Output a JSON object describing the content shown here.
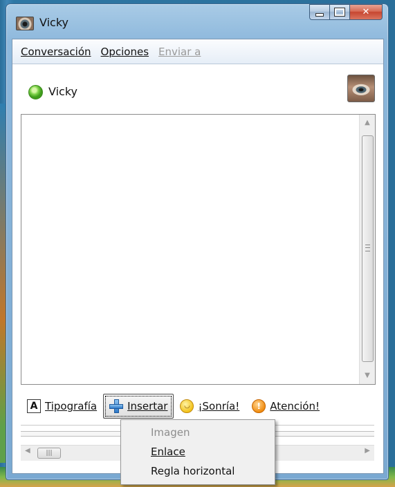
{
  "window": {
    "title": "Vicky"
  },
  "menubar": {
    "items": [
      {
        "label": "Conversación",
        "enabled": true
      },
      {
        "label": "Opciones",
        "enabled": true
      },
      {
        "label": "Enviar a",
        "enabled": false
      }
    ]
  },
  "contact": {
    "name": "Vicky",
    "status_color": "#5cbf2a"
  },
  "toolbar": {
    "typography_label": "Tipografía",
    "insert_label": "Insertar",
    "smile_label": "¡Sonría!",
    "attention_label": "Atención!"
  },
  "insert_menu": {
    "image_label": "Imagen",
    "link_label": "Enlace",
    "rule_label": "Regla horizontal"
  },
  "icons": {
    "typography": "letter-a-icon",
    "insert": "plus-icon",
    "smile": "smiley-icon",
    "attention": "exclamation-icon"
  }
}
